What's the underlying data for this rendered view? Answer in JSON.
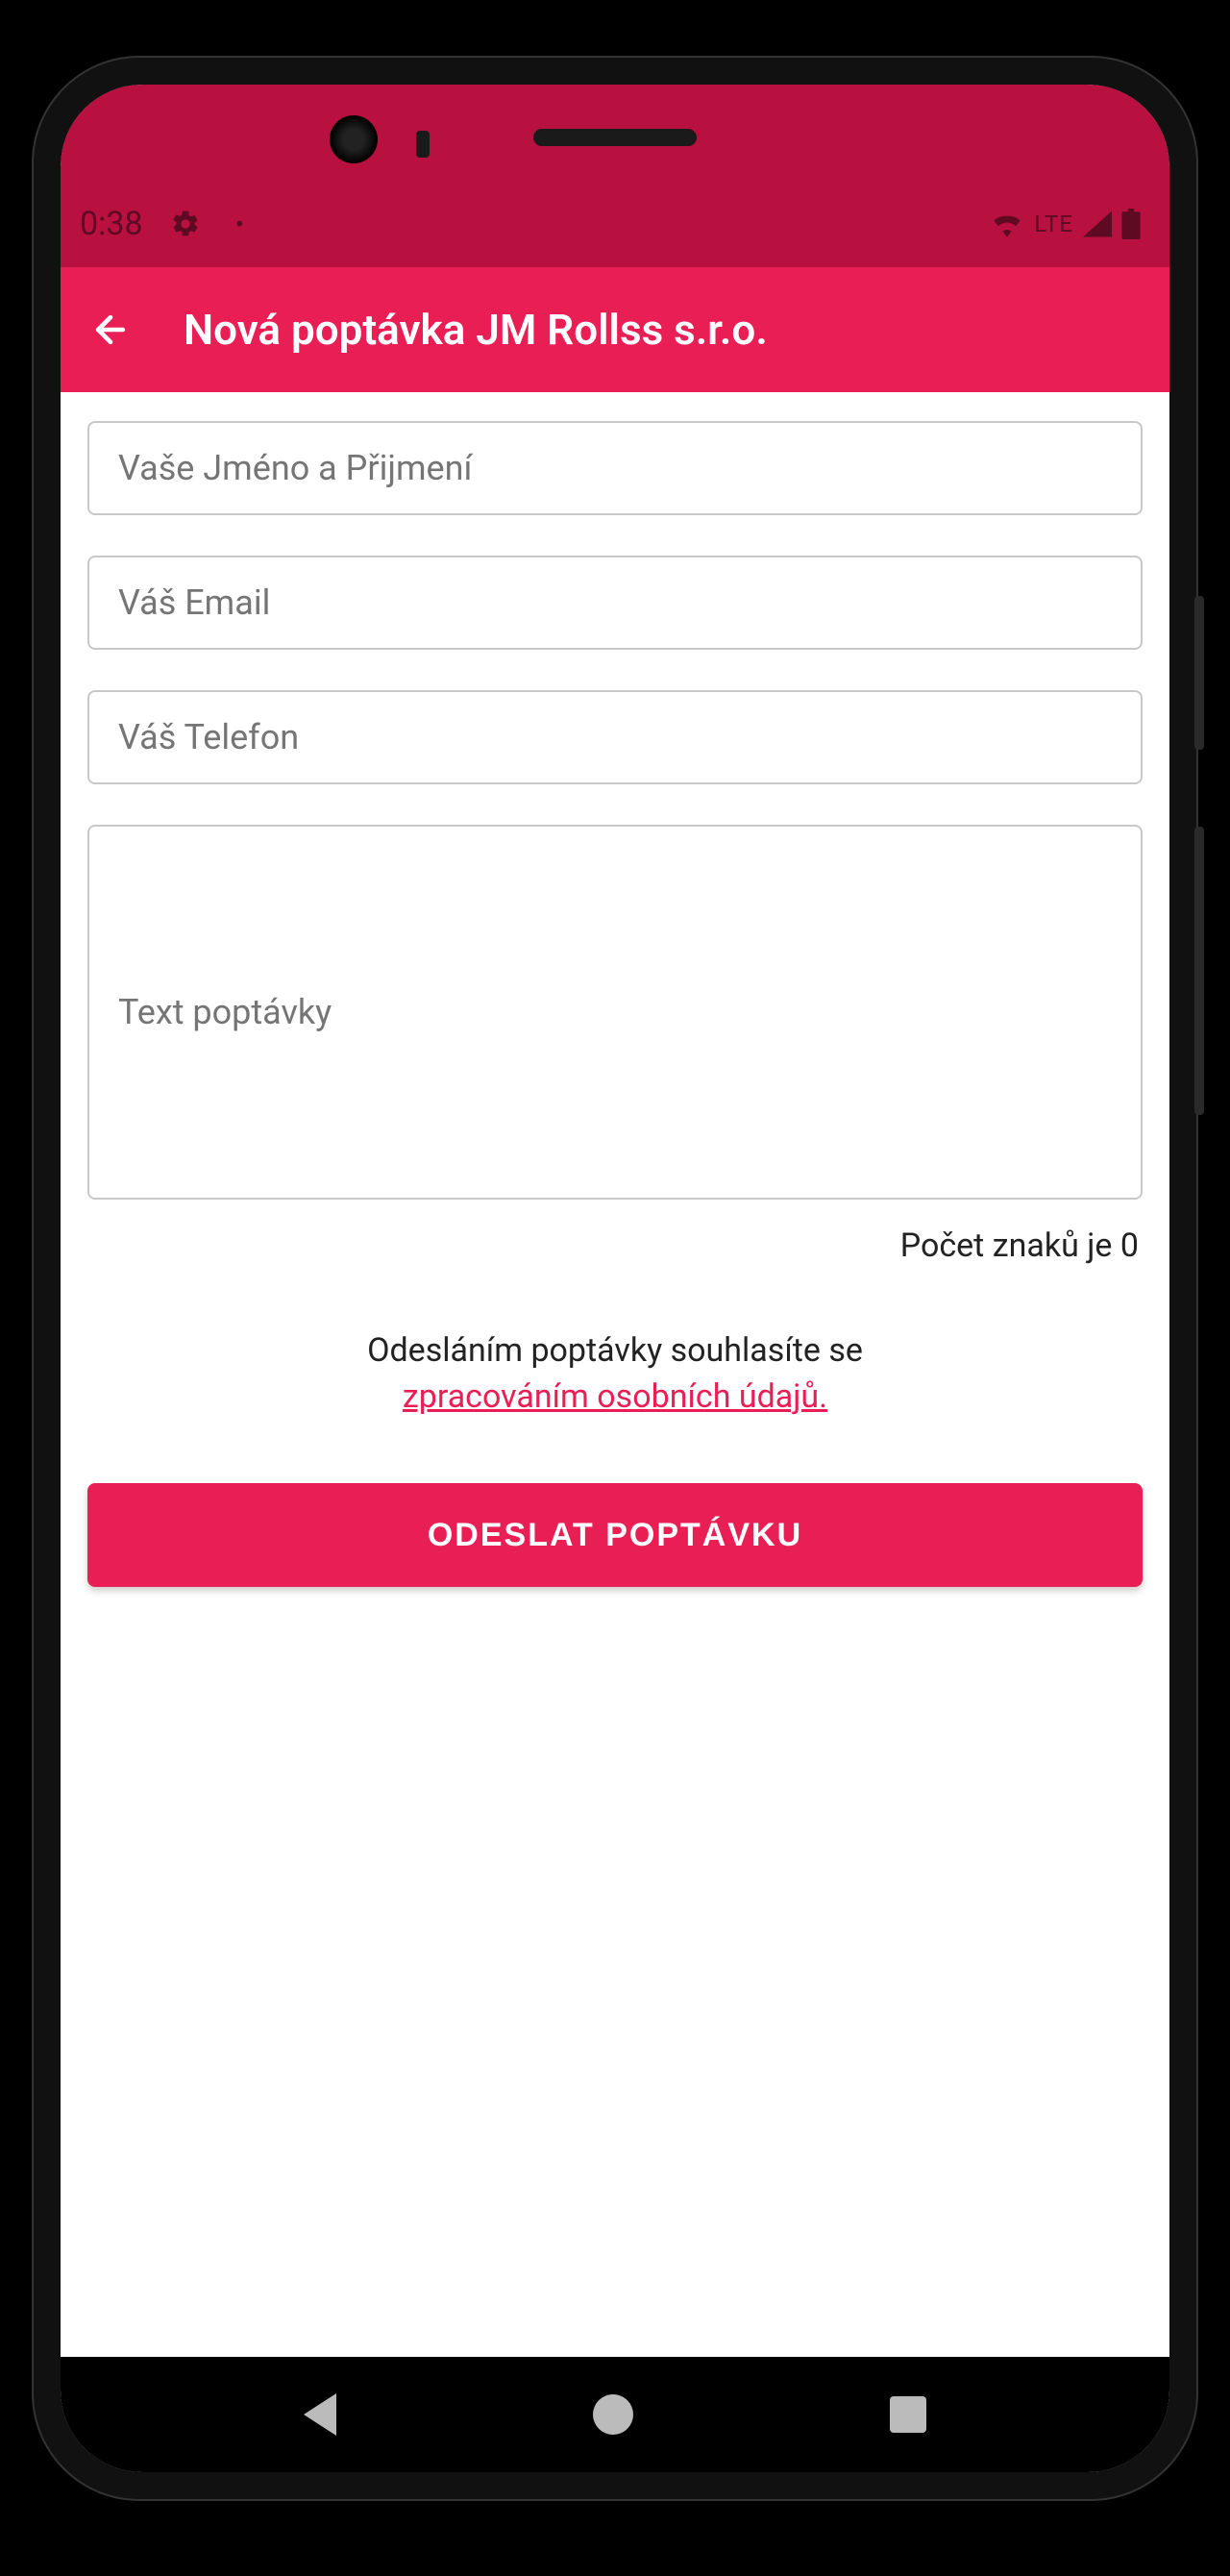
{
  "status": {
    "time": "0:38",
    "lte": "LTE"
  },
  "appbar": {
    "title": "Nová poptávka JM Rollss s.r.o."
  },
  "form": {
    "name_placeholder": "Vaše Jméno a Přijmení",
    "email_placeholder": "Váš Email",
    "phone_placeholder": "Váš Telefon",
    "message_placeholder": "Text poptávky",
    "char_count_prefix": "Počet znaků je ",
    "char_count_value": "0",
    "consent_text": "Odesláním poptávky souhlasíte se ",
    "consent_link": "zpracováním osobních údajů.",
    "submit_label": "ODESLAT POPTÁVKU"
  }
}
